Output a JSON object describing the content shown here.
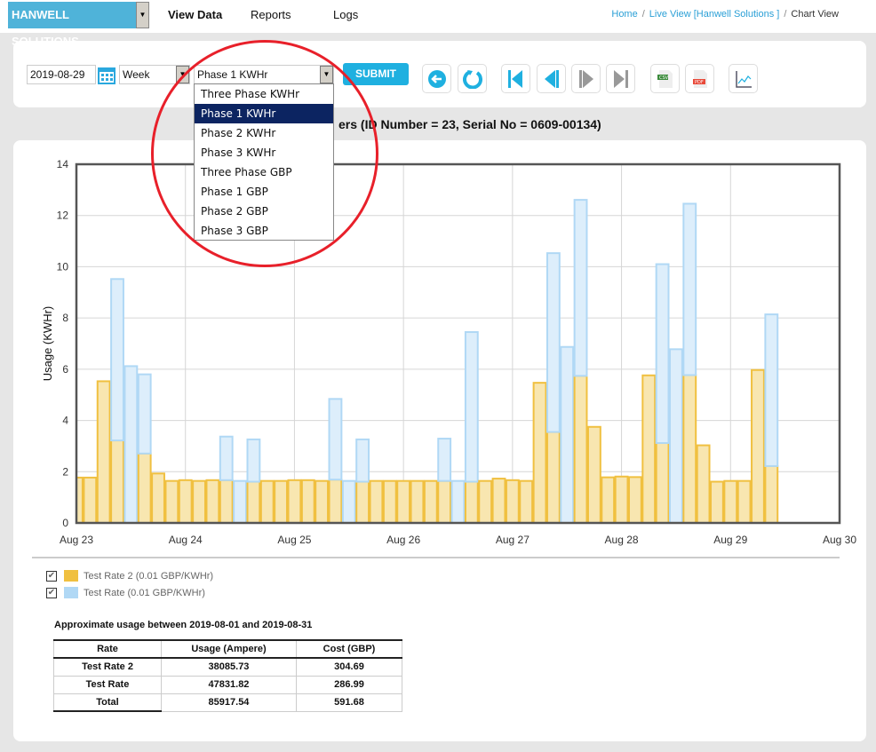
{
  "header": {
    "brand": "HANWELL SOLUTIONS",
    "nav": [
      "View Data",
      "Reports",
      "Logs"
    ],
    "breadcrumb": [
      "Home",
      "Live View [Hanwell Solutions ]",
      "Chart View"
    ]
  },
  "toolbar": {
    "date": "2019-08-29",
    "period": "Week",
    "measure": "Phase 1 KWHr",
    "submit": "SUBMIT",
    "icons": [
      "back-icon",
      "refresh-icon",
      "first-icon",
      "previous-icon",
      "next-icon",
      "last-icon",
      "csv-icon",
      "pdf-icon",
      "line-chart-icon"
    ],
    "options": [
      "Three Phase KWHr",
      "Phase 1 KWHr",
      "Phase 2 KWHr",
      "Phase 3 KWHr",
      "Three Phase GBP",
      "Phase 1 GBP",
      "Phase 2 GBP",
      "Phase 3 GBP"
    ],
    "selected_index": 1
  },
  "chart_title": "ers (ID Number = 23, Serial No = 0609-00134)",
  "chart_data": {
    "type": "bar",
    "stacked": true,
    "ylabel": "Usage (KWHr)",
    "ylim": [
      0,
      14
    ],
    "yticks": [
      "0",
      "2",
      "4",
      "6",
      "8",
      "10",
      "12",
      "14"
    ],
    "xticks": [
      "Aug 23",
      "Aug 24",
      "Aug 25",
      "Aug 26",
      "Aug 27",
      "Aug 28",
      "Aug 29",
      "Aug 30"
    ],
    "interval_hours": 3,
    "grid": true,
    "series": [
      {
        "name": "Test Rate 2 (0.01 GBP/KWHr)",
        "color": "#f0c040",
        "fill": "#f8e6b0",
        "values": [
          1.77,
          1.77,
          5.53,
          3.22,
          0,
          2.71,
          1.93,
          1.64,
          1.67,
          1.64,
          1.67,
          1.67,
          0,
          1.61,
          1.64,
          1.64,
          1.67,
          1.67,
          1.64,
          1.69,
          0,
          1.61,
          1.64,
          1.64,
          1.64,
          1.64,
          1.64,
          1.64,
          0,
          1.61,
          1.64,
          1.73,
          1.67,
          1.64,
          5.47,
          3.55,
          0,
          5.74,
          3.75,
          1.78,
          1.81,
          1.79,
          5.76,
          3.12,
          0,
          5.77,
          3.03,
          1.61,
          1.64,
          1.64,
          5.97,
          2.22
        ]
      },
      {
        "name": "Test Rate (0.01 GBP/KWHr)",
        "color": "#b0d8f5",
        "fill": "#ddeefb",
        "values": [
          0,
          0,
          0,
          6.3,
          6.12,
          3.09,
          0,
          0,
          0,
          0,
          0,
          1.7,
          1.64,
          1.65,
          0,
          0,
          0,
          0,
          0,
          3.15,
          1.64,
          1.65,
          0,
          0,
          0,
          0,
          0,
          1.65,
          1.64,
          5.84,
          0,
          0,
          0,
          0,
          0,
          6.98,
          6.87,
          6.87,
          0,
          0,
          0,
          0,
          0,
          6.98,
          6.78,
          6.69,
          0,
          0,
          0,
          0,
          0,
          5.92
        ]
      }
    ]
  },
  "legend": [
    {
      "label": "Test Rate 2 (0.01 GBP/KWHr)",
      "checked": true
    },
    {
      "label": "Test Rate (0.01 GBP/KWHr)",
      "checked": true
    }
  ],
  "usage": {
    "title": "Approximate usage between 2019-08-01 and 2019-08-31",
    "headers": [
      "Rate",
      "Usage (Ampere)",
      "Cost (GBP)"
    ],
    "rows": [
      [
        "Test Rate 2",
        "38085.73",
        "304.69"
      ],
      [
        "Test Rate",
        "47831.82",
        "286.99"
      ],
      [
        "Total",
        "85917.54",
        "591.68"
      ]
    ]
  }
}
